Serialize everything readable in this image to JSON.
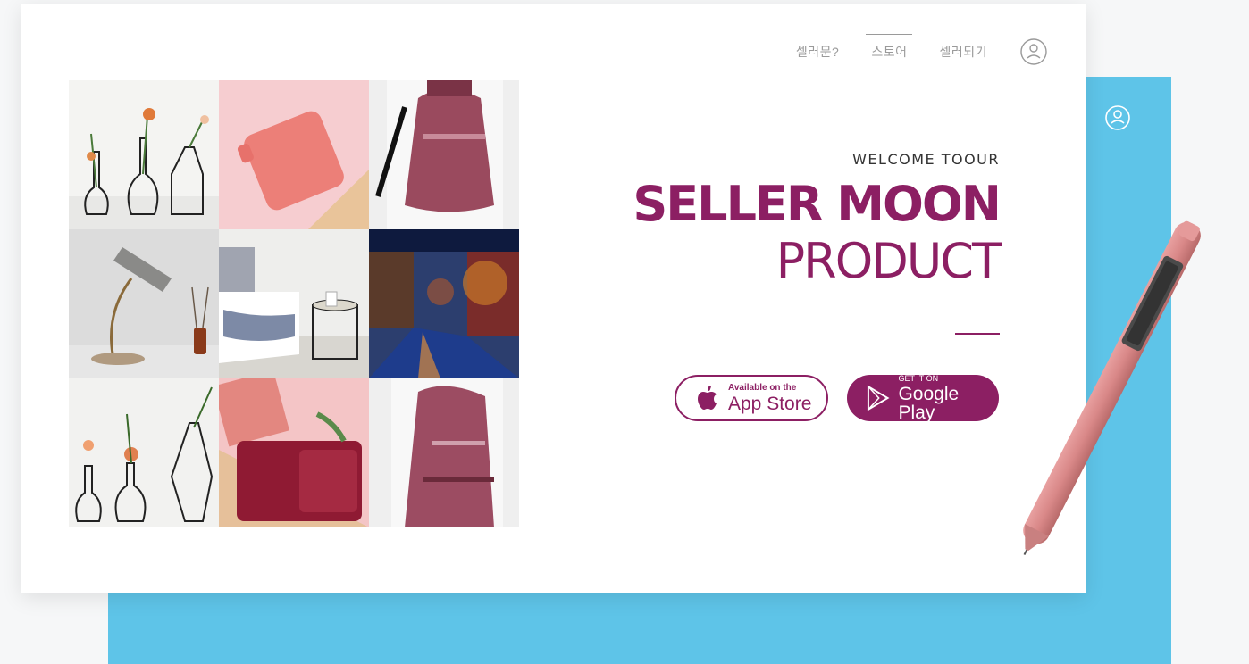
{
  "nav": {
    "items": [
      {
        "label": "셀러문?"
      },
      {
        "label": "스토어"
      },
      {
        "label": "셀러되기"
      }
    ]
  },
  "hero": {
    "welcome": "WELCOME TOOUR",
    "title": "SELLER MOON",
    "subtitle": "PRODUCT"
  },
  "buttons": {
    "app_store": {
      "small": "Available on the",
      "big": "App Store"
    },
    "google_play": {
      "small": "GET IT ON",
      "big": "Google Play"
    }
  },
  "colors": {
    "brand": "#8c1f63",
    "panel": "#5ec4e8"
  },
  "icons": {
    "user": "user-circle-icon",
    "apple": "apple-logo-icon",
    "play": "google-play-icon"
  },
  "gallery": {
    "tiles": [
      "vases",
      "pink-pouch",
      "backpack",
      "desk-lamp",
      "bedroom",
      "canal-city",
      "vases-flowers",
      "red-wallet",
      "backpack-back"
    ]
  }
}
